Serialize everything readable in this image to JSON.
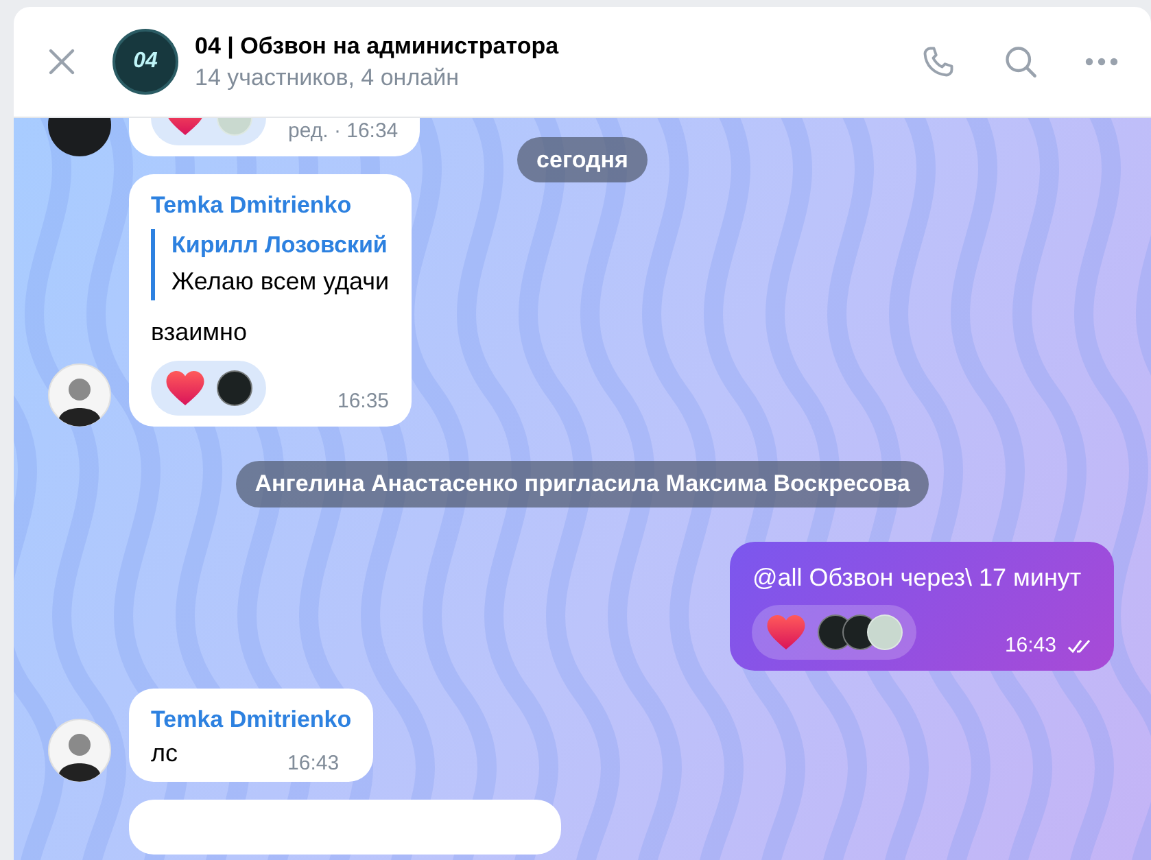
{
  "header": {
    "title": "04 | Обзвон на администратора",
    "subtitle": "14 участников, 4 онлайн",
    "avatar_text": "04"
  },
  "date_pill": "сегодня",
  "messages": [
    {
      "kind": "incoming",
      "avatar": {
        "kind": "dark"
      },
      "partial": true,
      "reactions": [
        {
          "kind": "heart",
          "reactors": [
            {
              "kind": "light"
            }
          ]
        }
      ],
      "time": "ред. · 16:34"
    },
    {
      "kind": "incoming",
      "avatar": {
        "kind": "light"
      },
      "partial": false,
      "author": "Temka Dmitrienko",
      "reply": {
        "author": "Кирилл Лозовский",
        "text": "Желаю всем удачи"
      },
      "text": "взаимно",
      "reactions": [
        {
          "kind": "heart",
          "reactors": [
            {
              "kind": "dark"
            }
          ]
        }
      ],
      "time": "16:35"
    },
    {
      "kind": "service",
      "text": "**Ангелина Анастасенко** пригласила **Максима Воскресова**"
    },
    {
      "kind": "outgoing",
      "text": "@all Обзвон через\\ 17 минут",
      "reactions": [
        {
          "kind": "heart",
          "reactors": [
            {
              "kind": "dark"
            },
            {
              "kind": "dark"
            },
            {
              "kind": "light"
            }
          ]
        }
      ],
      "time": "16:43",
      "read": true
    },
    {
      "kind": "incoming",
      "avatar": {
        "kind": "light"
      },
      "partial": false,
      "author": "Temka Dmitrienko",
      "text": "лс",
      "time": "16:43",
      "inline_time": true
    },
    {
      "kind": "cut"
    }
  ]
}
